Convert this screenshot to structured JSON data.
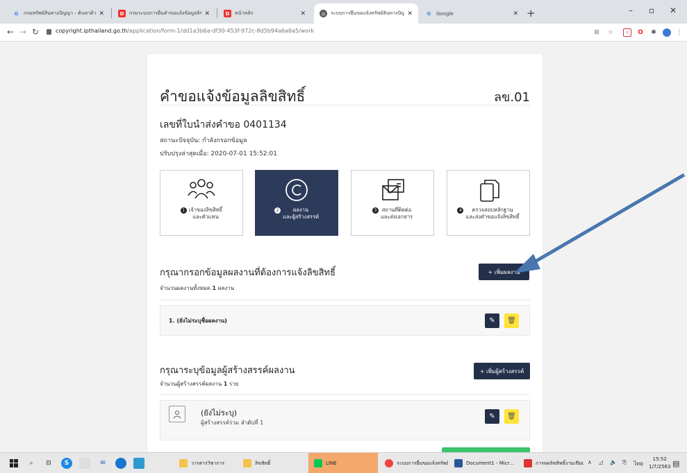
{
  "browser": {
    "tabs": [
      {
        "title": "กรมทรัพย์สินทางปัญญา - ค้นหาด้าน...",
        "icon": "google-icon"
      },
      {
        "title": "กรมระบบการยื่นคำขอแจ้งข้อมูลลิขสิทธิ์",
        "icon": "dip-icon"
      },
      {
        "title": "หน้าหลัก",
        "icon": "dip-icon"
      },
      {
        "title": "ระบบการยื่นขอแจ้งทรัพย์สินทางปัญญา",
        "icon": "globe-icon"
      },
      {
        "title": "Google",
        "icon": "google-icon"
      }
    ],
    "url_host": "copyright.ipthailand.go.th",
    "url_path": "/application/form-1/dd1a3b6a-df30-453f-972c-8d5b94a6a6a5/work"
  },
  "page": {
    "title": "คำขอแจ้งข้อมูลลิขสิทธิ์",
    "form_code": "ลข.01",
    "request_no": "เลขที่ใบนำส่งคำขอ 0401134",
    "status": "สถานะปัจจุบัน: กำลังกรอกข้อมูล",
    "updated": "ปรับปรุงล่าสุดเมื่อ: 2020-07-01 15:52:01",
    "steps": [
      {
        "num": "1",
        "line1": "เจ้าของลิขสิทธิ์",
        "line2": "และตัวแทน"
      },
      {
        "num": "2",
        "line1": "ผลงาน",
        "line2": "และผู้สร้างสรรค์"
      },
      {
        "num": "3",
        "line1": "สถานที่ติดต่อ",
        "line2": "และส่งเอกสาร"
      },
      {
        "num": "4",
        "line1": "ตรวจสอบหลักฐาน",
        "line2": "และส่งคำขอแจ้งลิขสิทธิ์"
      }
    ],
    "works_section": {
      "title": "กรุณากรอกข้อมูลผลงานที่ต้องการแจ้งลิขสิทธิ์",
      "count_prefix": "จำนวนผลงานทั้งหมด ",
      "count": "1",
      "count_suffix": " ผลงาน",
      "add_label": "+ เพิ่มผลงาน",
      "item": "1. (ยังไม่ระบุชื่อผลงาน)"
    },
    "creators_section": {
      "title": "กรุณาระบุข้อมูลผู้สร้างสรรค์ผลงาน",
      "count_prefix": "จำนวนผู้สร้างสรรค์ผลงาน ",
      "count": "1",
      "count_suffix": " ราย",
      "add_label": "+ เพิ่มผู้สร้างสรรค์",
      "item_name": "(ยังไม่ระบุ)",
      "item_role": "ผู้สร้างสรรค์ร่วม ลำดับที่ 1"
    }
  },
  "taskbar": {
    "items": [
      {
        "label": "วารสารวิชาการ"
      },
      {
        "label": "ลิขสิทธิ์"
      },
      {
        "label": "LINE"
      },
      {
        "label": "ระบบการยื่นขอแจ้งทรัพย์..."
      },
      {
        "label": "Document1 - Micr..."
      },
      {
        "label": "การจดลิขสิทธิ์งานเขียน..."
      }
    ],
    "lang": "ไทย",
    "time": "15:52",
    "date": "1/7/2563"
  },
  "colors": {
    "primary": "#24304a",
    "active_step": "#2d3b5a",
    "delete": "#ffe338",
    "arrow": "#4a76b0",
    "green": "#3bc46b"
  }
}
